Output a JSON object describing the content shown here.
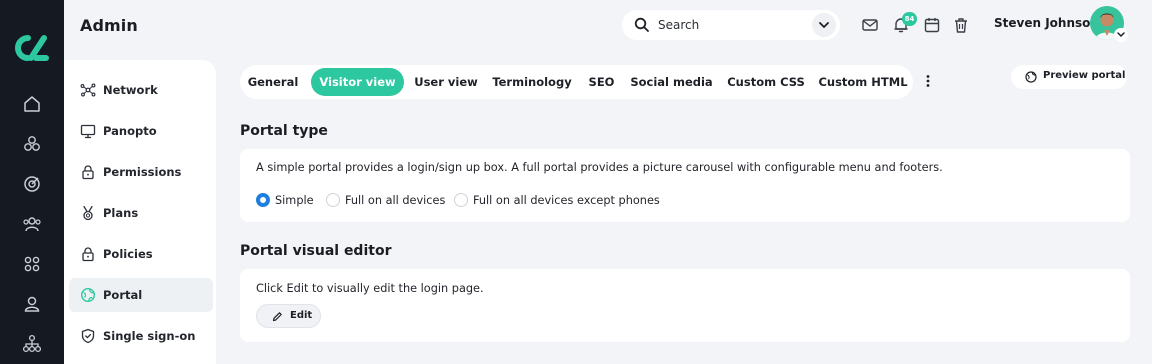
{
  "app": {
    "title": "Admin"
  },
  "colors": {
    "accent": "#2dc7a0",
    "rail": "#141922",
    "radio_selected": "#1d7fe0"
  },
  "search": {
    "placeholder": "Search"
  },
  "header": {
    "notification_count": "84",
    "user_name": "Steven Johnson",
    "icons": [
      "mail-icon",
      "bell-icon",
      "calendar-icon",
      "trash-icon"
    ]
  },
  "rail": {
    "icons": [
      "home-icon",
      "cubes-icon",
      "target-icon",
      "users-icon",
      "grid-icon",
      "user-icon",
      "sitemap-icon"
    ]
  },
  "sidebar": {
    "items": [
      {
        "label": "Network",
        "icon": "network-icon"
      },
      {
        "label": "Panopto",
        "icon": "monitor-icon"
      },
      {
        "label": "Permissions",
        "icon": "lock-icon"
      },
      {
        "label": "Plans",
        "icon": "medal-icon"
      },
      {
        "label": "Policies",
        "icon": "lock-icon"
      },
      {
        "label": "Portal",
        "icon": "globe-icon",
        "active": true
      },
      {
        "label": "Single sign-on",
        "icon": "shield-icon"
      }
    ]
  },
  "tabs": [
    {
      "label": "General"
    },
    {
      "label": "Visitor view",
      "active": true
    },
    {
      "label": "User view"
    },
    {
      "label": "Terminology"
    },
    {
      "label": "SEO"
    },
    {
      "label": "Social media"
    },
    {
      "label": "Custom CSS"
    },
    {
      "label": "Custom HTML"
    }
  ],
  "preview_button": {
    "label": "Preview portal"
  },
  "portal_type": {
    "heading": "Portal type",
    "description": "A simple portal provides a login/sign up box. A full portal provides a picture carousel with configurable menu and footers.",
    "options": [
      {
        "label": "Simple",
        "selected": true
      },
      {
        "label": "Full on all devices",
        "selected": false
      },
      {
        "label": "Full on all devices except phones",
        "selected": false
      }
    ]
  },
  "visual_editor": {
    "heading": "Portal visual editor",
    "description": "Click Edit to visually edit the login page.",
    "edit_label": "Edit"
  }
}
